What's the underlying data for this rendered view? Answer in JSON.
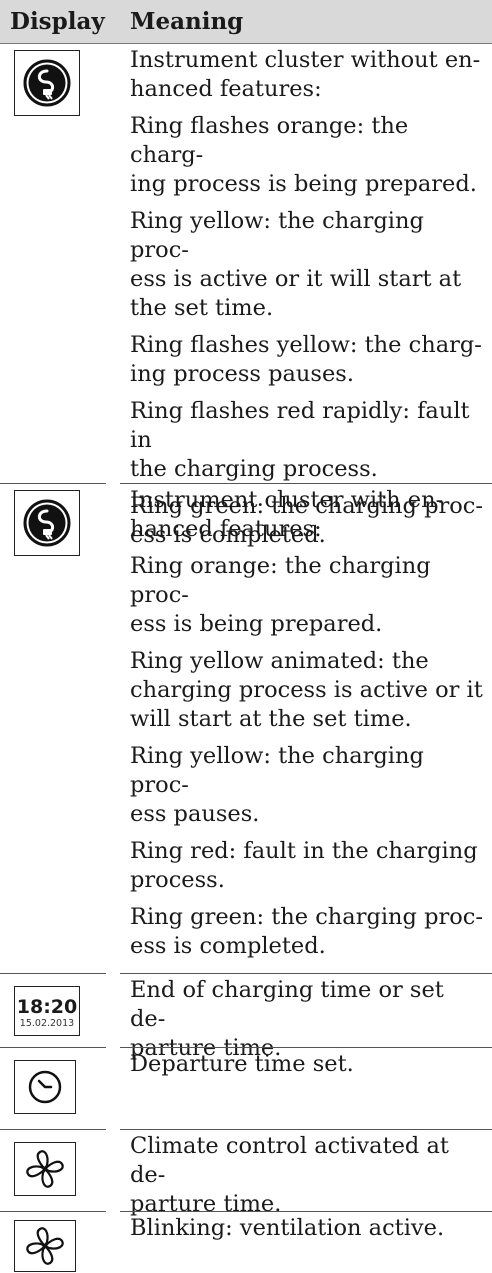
{
  "header": {
    "display": "Display",
    "meaning": "Meaning"
  },
  "rows": [
    {
      "icon": "charging-plug-icon",
      "lines": [
        "Instrument cluster without en-\nhanced features:",
        "Ring flashes orange: the charg-\ning process is being prepared.",
        "Ring yellow: the charging proc-\ness is active or it will start at\nthe set time.",
        "Ring flashes yellow: the charg-\ning process pauses.",
        "Ring flashes red rapidly: fault in\nthe charging process.",
        "Ring green: the charging proc-\ness is completed."
      ]
    },
    {
      "icon": "charging-plug-icon",
      "lines": [
        "Instrument cluster with en-\nhanced features:",
        "Ring orange: the charging proc-\ness is being prepared.",
        "Ring yellow animated: the\ncharging process is active or it\nwill start at the set time.",
        "Ring yellow: the charging proc-\ness pauses.",
        "Ring red: fault in the charging\nprocess.",
        "Ring green: the charging proc-\ness is completed."
      ]
    },
    {
      "icon": "clock-display-icon",
      "time": "18:20",
      "date": "15.02.2013",
      "lines": [
        "End of charging time or set de-\nparture time."
      ]
    },
    {
      "icon": "departure-time-icon",
      "lines": [
        "Departure time set."
      ]
    },
    {
      "icon": "fan-icon",
      "lines": [
        "Climate control activated at de-\nparture time."
      ]
    },
    {
      "icon": "fan-icon",
      "lines": [
        "Blinking: ventilation active."
      ]
    }
  ]
}
